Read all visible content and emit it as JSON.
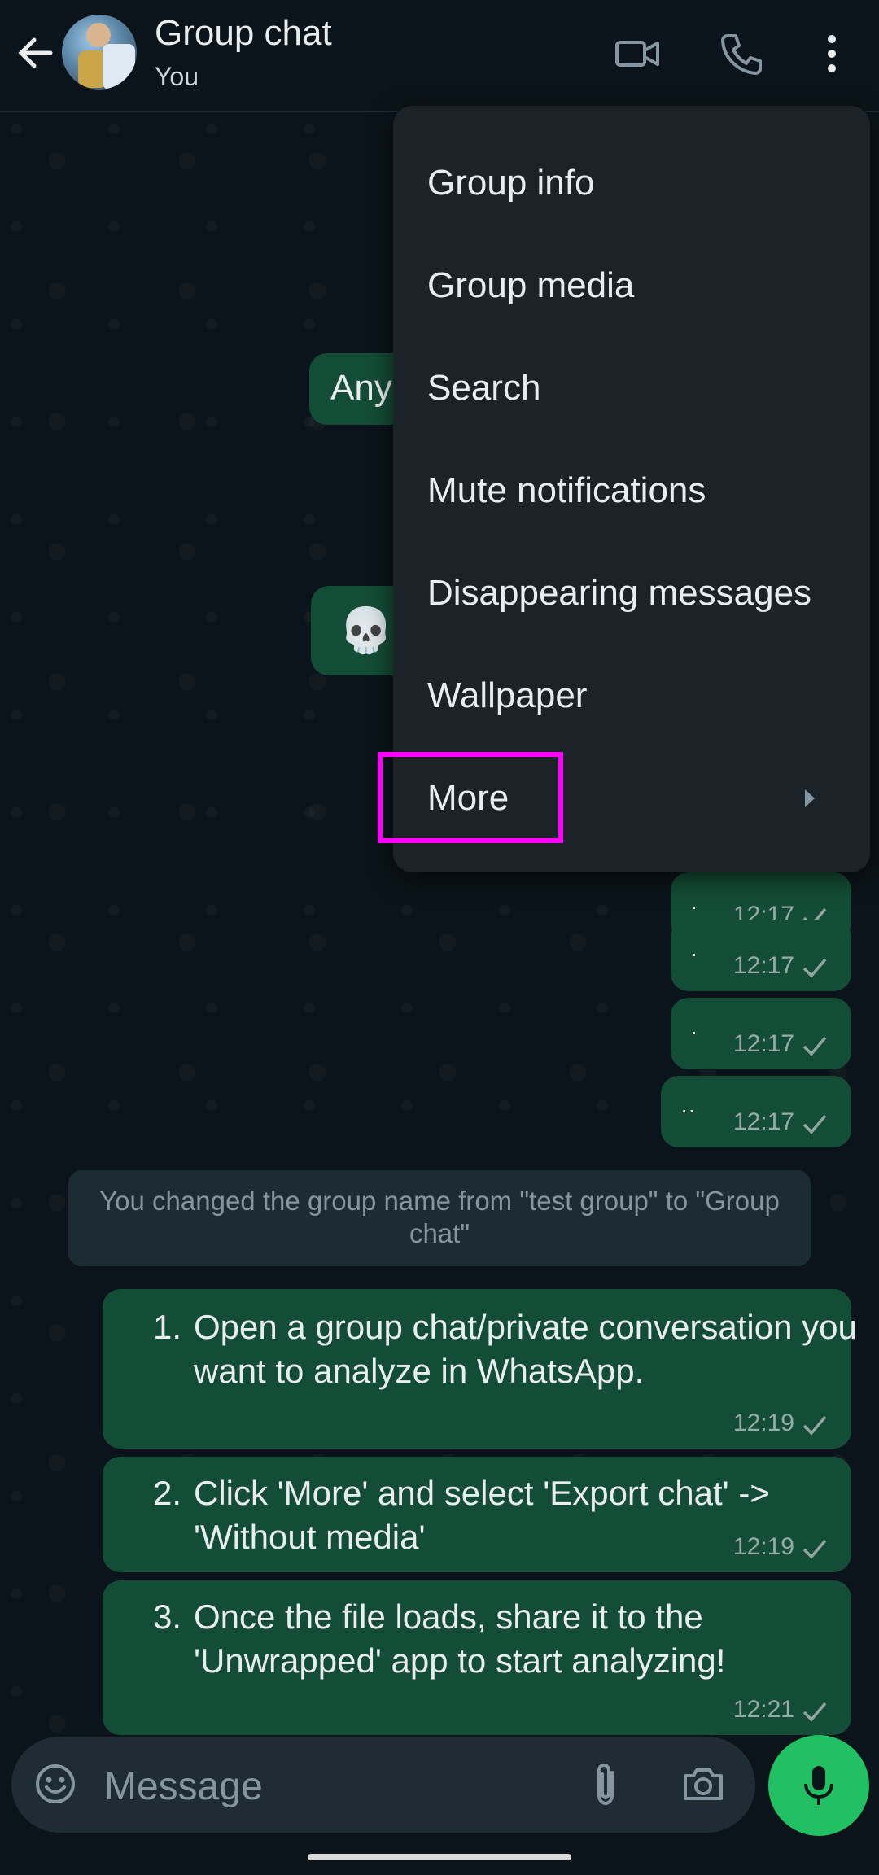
{
  "header": {
    "title": "Group chat",
    "subtitle": "You"
  },
  "menu": {
    "items": [
      {
        "label": "Group info"
      },
      {
        "label": "Group media"
      },
      {
        "label": "Search"
      },
      {
        "label": "Mute notifications"
      },
      {
        "label": "Disappearing messages"
      },
      {
        "label": "Wallpaper"
      },
      {
        "label": "More"
      }
    ]
  },
  "messages": {
    "partial_1": "Any",
    "partial_2": "💀",
    "short": [
      {
        "text": "·",
        "time": "12:17"
      },
      {
        "text": "·",
        "time": "12:17"
      },
      {
        "text": "·",
        "time": "12:17"
      },
      {
        "text": "··",
        "time": "12:17"
      }
    ],
    "system": "You changed the group name from \"test group\" to \"Group chat\"",
    "list": [
      {
        "num": "1.",
        "text": "Open a group chat/private conversation you want to analyze in WhatsApp.",
        "time": "12:19"
      },
      {
        "num": "2.",
        "text": "Click 'More' and select 'Export chat' -> 'Without media'",
        "time": "12:19"
      },
      {
        "num": "3.",
        "text": "Once the file loads, share it to the 'Unwrapped' app to start analyzing!",
        "time": "12:21"
      }
    ]
  },
  "input": {
    "placeholder": "Message"
  },
  "colors": {
    "background": "#0b141a",
    "bubble": "#144d37",
    "menu": "#1b2329",
    "accent": "#21c063",
    "highlight": "#ff00ff"
  }
}
